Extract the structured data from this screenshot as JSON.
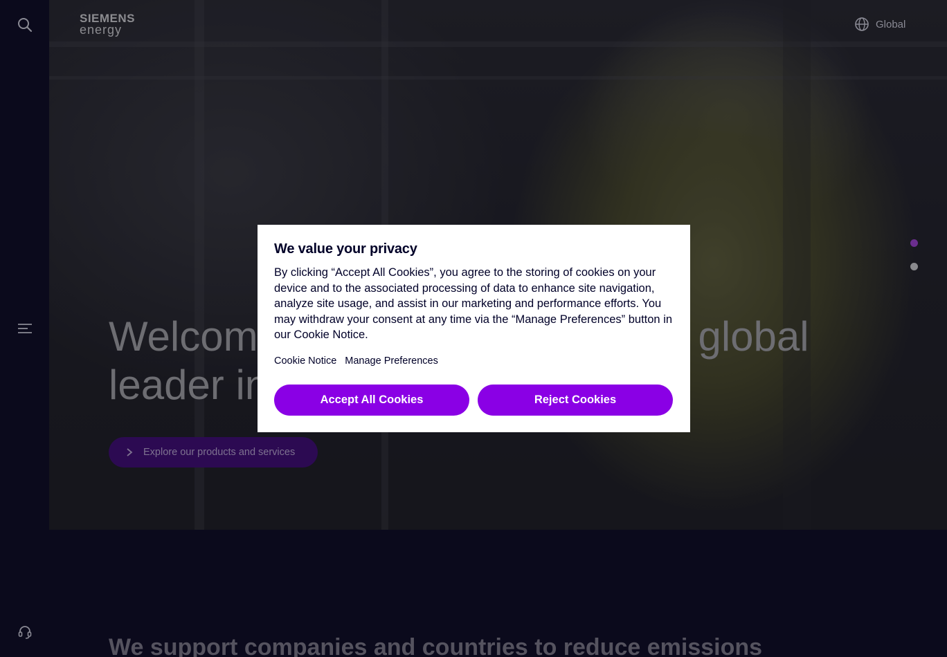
{
  "header": {
    "logo_line1": "SIEMENS",
    "logo_line2": "energy",
    "region_label": "Global"
  },
  "rail": {
    "search_icon": "search-icon",
    "menu_icon": "hamburger-menu-icon",
    "support_icon": "headset-icon"
  },
  "hero": {
    "title": "Welcome to Siemens Energy, a global leader in energy technology",
    "cta_label": "Explore our products and services",
    "slides": [
      {
        "active": true,
        "color": "#6b2e8f"
      },
      {
        "active": false,
        "color": "#8a8a8e"
      }
    ]
  },
  "section": {
    "title": "We support companies and countries to reduce emissions"
  },
  "cookie_modal": {
    "title": "We value your privacy",
    "body": "By clicking “Accept All Cookies”, you agree to the storing of cookies on your device and to the associated processing of data to enhance site navigation, analyze site usage, and assist in our marketing and performance efforts. You may withdraw your consent at any time via the “Manage Preferences” button in our Cookie Notice.",
    "link_cookie_notice": "Cookie Notice",
    "link_manage_preferences": "Manage Preferences",
    "accept_label": "Accept All Cookies",
    "reject_label": "Reject Cookies",
    "button_color": "#8a00e5"
  }
}
